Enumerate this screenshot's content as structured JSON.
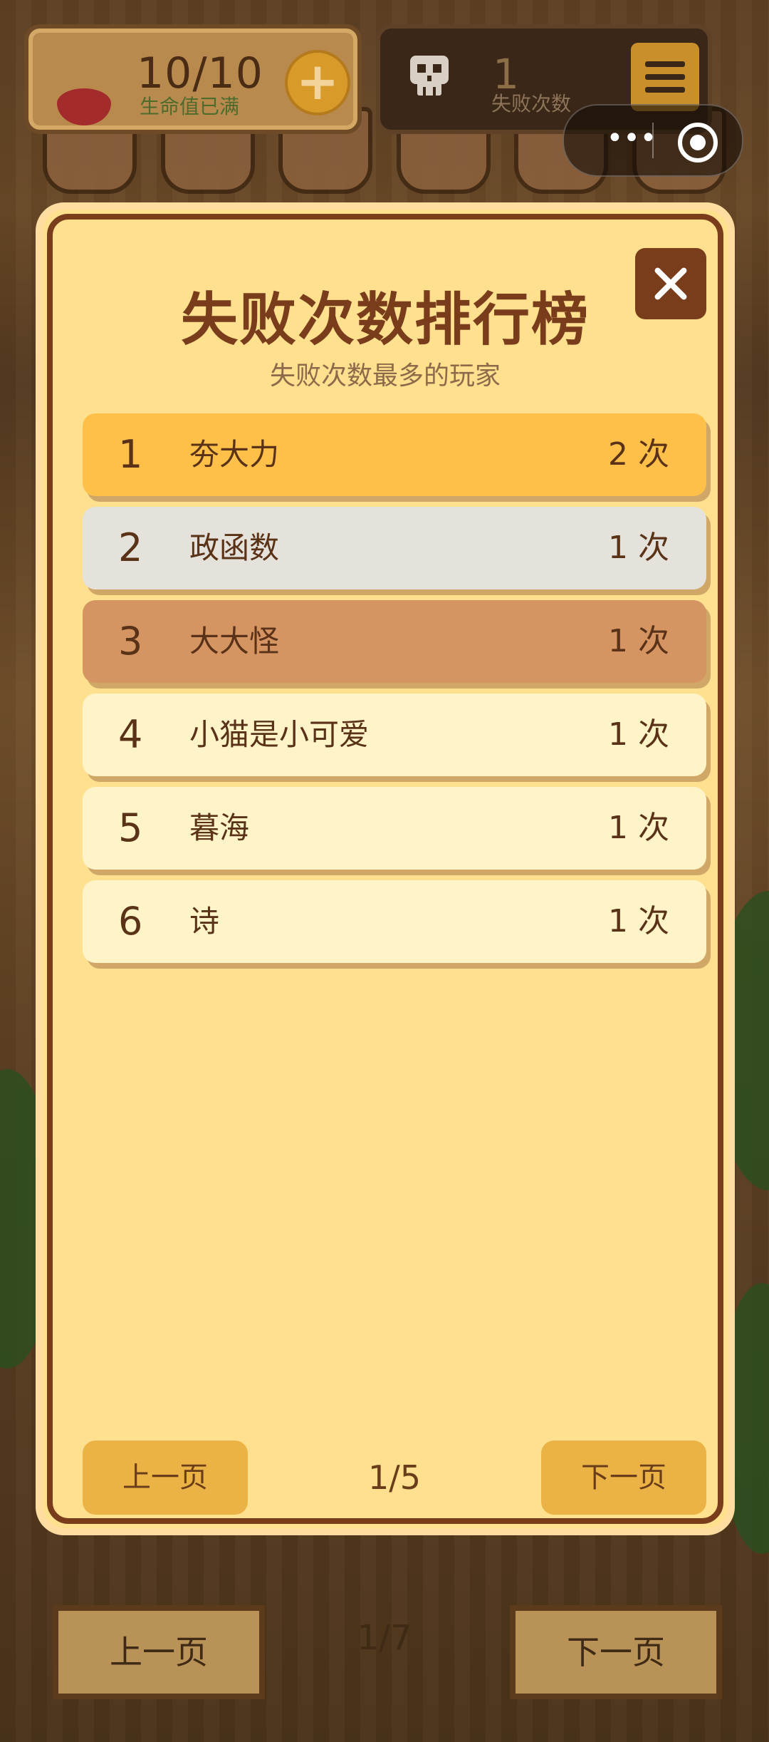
{
  "hud": {
    "lives": "10/10",
    "lives_status": "生命值已满",
    "fail_count": "1",
    "fail_label": "失败次数"
  },
  "capsule": {
    "more": "•••"
  },
  "background": {
    "prev_label": "上一页",
    "next_label": "下一页",
    "page": "1/7"
  },
  "modal": {
    "title": "失败次数排行榜",
    "subtitle": "失败次数最多的玩家",
    "rows": [
      {
        "rank": "1",
        "name": "夯大力",
        "count": "2 次",
        "color": "#ffc04a"
      },
      {
        "rank": "2",
        "name": "政函数",
        "count": "1 次",
        "color": "#e4e2da"
      },
      {
        "rank": "3",
        "name": "大大怪",
        "count": "1 次",
        "color": "#d59563"
      },
      {
        "rank": "4",
        "name": "小猫是小可爱",
        "count": "1 次",
        "color": "#fff3c8"
      },
      {
        "rank": "5",
        "name": "暮海",
        "count": "1 次",
        "color": "#fff3c8"
      },
      {
        "rank": "6",
        "name": "诗",
        "count": "1 次",
        "color": "#fff3c8"
      }
    ],
    "prev_label": "上一页",
    "next_label": "下一页",
    "page": "1/5"
  }
}
